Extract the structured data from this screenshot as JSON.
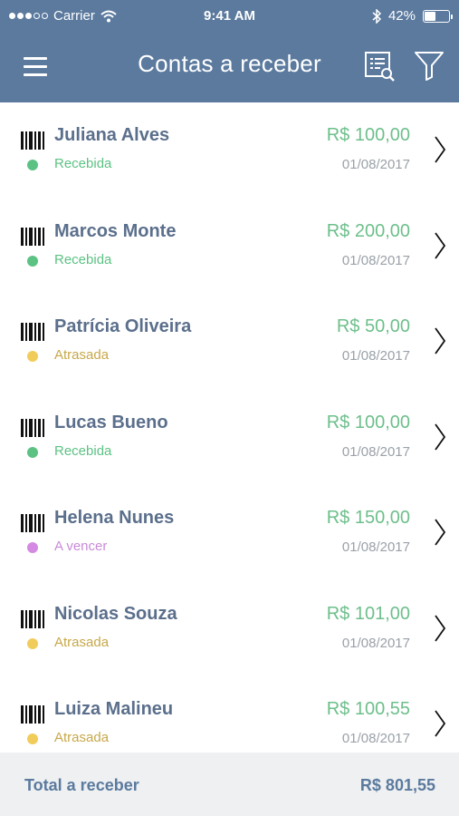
{
  "status_bar": {
    "carrier": "Carrier",
    "time": "9:41 AM",
    "battery": "42%",
    "battery_level": 0.42,
    "signal_bars_filled": 3,
    "signal_bars_total": 5
  },
  "header": {
    "title": "Contas a receber",
    "color": "#5b7a9e",
    "icons": [
      "menu-icon",
      "report-search-icon",
      "filter-icon"
    ]
  },
  "status_colors": {
    "Recebida": "#5cc283",
    "Atrasada": "#f2cc5b",
    "A vencer": "#d48ae2"
  },
  "status_text_colors": {
    "Recebida": "#5cc283",
    "Atrasada": "#c8a84a",
    "A vencer": "#c98ad8"
  },
  "items": [
    {
      "name": "Juliana Alves",
      "status": "Recebida",
      "amount": "R$ 100,00",
      "date": "01/08/2017"
    },
    {
      "name": "Marcos Monte",
      "status": "Recebida",
      "amount": "R$ 200,00",
      "date": "01/08/2017"
    },
    {
      "name": "Patrícia Oliveira",
      "status": "Atrasada",
      "amount": "R$ 50,00",
      "date": "01/08/2017"
    },
    {
      "name": "Lucas Bueno",
      "status": "Recebida",
      "amount": "R$ 100,00",
      "date": "01/08/2017"
    },
    {
      "name": "Helena Nunes",
      "status": "A vencer",
      "amount": "R$ 150,00",
      "date": "01/08/2017"
    },
    {
      "name": "Nicolas Souza",
      "status": "Atrasada",
      "amount": "R$ 101,00",
      "date": "01/08/2017"
    },
    {
      "name": "Luiza Malineu",
      "status": "Atrasada",
      "amount": "R$ 100,55",
      "date": "01/08/2017"
    }
  ],
  "footer": {
    "label": "Total a receber",
    "value": "R$ 801,55"
  }
}
